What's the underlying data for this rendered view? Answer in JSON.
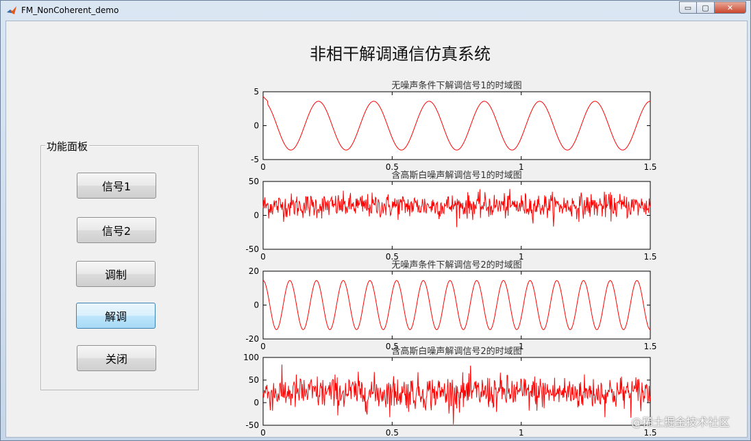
{
  "window": {
    "title": "FM_NonCoherent_demo",
    "min_label": "▭",
    "max_label": "▢",
    "close_label": "✕"
  },
  "app_title": "非相干解调通信仿真系统",
  "panel": {
    "title": "功能面板",
    "buttons": [
      {
        "label": "信号1",
        "active": false
      },
      {
        "label": "信号2",
        "active": false
      },
      {
        "label": "调制",
        "active": false
      },
      {
        "label": "解调",
        "active": true
      },
      {
        "label": "关闭",
        "active": false
      }
    ]
  },
  "colors": {
    "trace": "#ff0000",
    "accent": "#3c7fb1"
  },
  "watermark": {
    "brand": "@稀土掘金技术社区",
    "url": "https://blog.csdn.net/weixin_..."
  },
  "chart_data": [
    {
      "type": "line",
      "title": "无噪声条件下解调信号1的时域图",
      "xlim": [
        0,
        1.5
      ],
      "ylim": [
        -5,
        5
      ],
      "xticks": [
        "0",
        "0.5",
        "1",
        "1.5"
      ],
      "yticks": [
        "5",
        "0",
        "-5"
      ],
      "series": [
        {
          "kind": "sine",
          "amplitude": 3.6,
          "periods": 7,
          "phase_deg": 90,
          "noise": 0,
          "start_spike": 4.3
        }
      ]
    },
    {
      "type": "line",
      "title": "含高斯白噪声解调信号1的时域图",
      "xlim": [
        0,
        1.5
      ],
      "ylim": [
        -50,
        50
      ],
      "xticks": [
        "0",
        "0.5",
        "1",
        "1.5"
      ],
      "yticks": [
        "50",
        "0",
        "-50"
      ],
      "series": [
        {
          "kind": "noise",
          "mean": 14,
          "spread": 9,
          "points": 700
        }
      ]
    },
    {
      "type": "line",
      "title": "无噪声条件下解调信号2的时域图",
      "xlim": [
        0,
        1.5
      ],
      "ylim": [
        -20,
        20
      ],
      "xticks": [
        "0",
        "0.5",
        "1",
        "1.5"
      ],
      "yticks": [
        "20",
        "0",
        "-20"
      ],
      "series": [
        {
          "kind": "sine",
          "amplitude": 14.5,
          "periods": 14.5,
          "phase_deg": 90,
          "noise": 0,
          "start_spike": 0
        }
      ]
    },
    {
      "type": "line",
      "title": "含高斯白噪声解调信号2的时域图",
      "xlim": [
        0,
        1.5
      ],
      "ylim": [
        -50,
        100
      ],
      "xticks": [
        "0",
        "0.5",
        "1",
        "1.5"
      ],
      "yticks": [
        "100",
        "50",
        "0",
        "-50"
      ],
      "series": [
        {
          "kind": "noise",
          "mean": 22,
          "spread": 19,
          "points": 700
        }
      ]
    }
  ]
}
